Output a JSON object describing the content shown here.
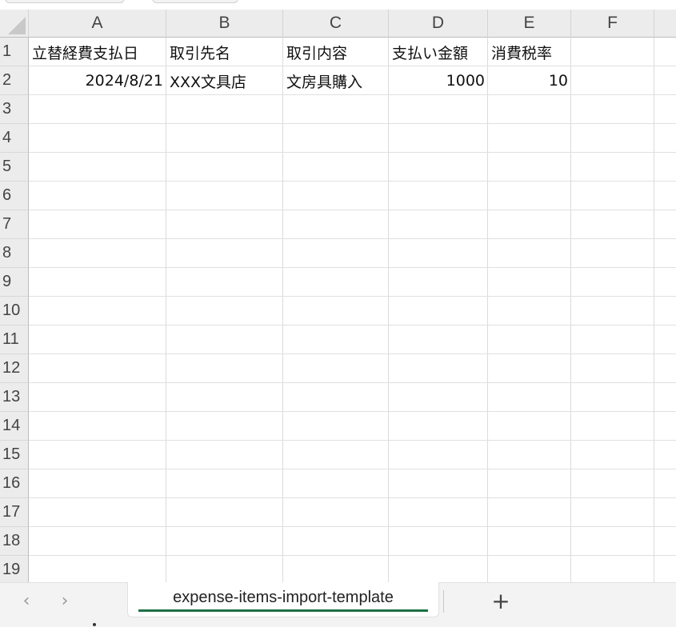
{
  "spreadsheet": {
    "columns": [
      "A",
      "B",
      "C",
      "D",
      "E",
      "F"
    ],
    "rows": [
      "1",
      "2",
      "3",
      "4",
      "5",
      "6",
      "7",
      "8",
      "9",
      "10",
      "11",
      "12",
      "13",
      "14",
      "15",
      "16",
      "17",
      "18",
      "19"
    ],
    "cells": {
      "A1": "立替経費支払日",
      "B1": "取引先名",
      "C1": "取引内容",
      "D1": "支払い金額",
      "E1": "消費税率",
      "A2": "2024/8/21",
      "B2": "XXX文具店",
      "C2": "文房具購入",
      "D2": "1000",
      "E2": "10"
    }
  },
  "tabbar": {
    "prev_icon": "chevron-left-icon",
    "next_icon": "chevron-right-icon",
    "prev_glyph": "‹",
    "next_glyph": "›",
    "active_sheet": "expense-items-import-template",
    "add_icon": "plus-icon",
    "add_glyph": "+",
    "active_underline_color": "#1e7145"
  }
}
